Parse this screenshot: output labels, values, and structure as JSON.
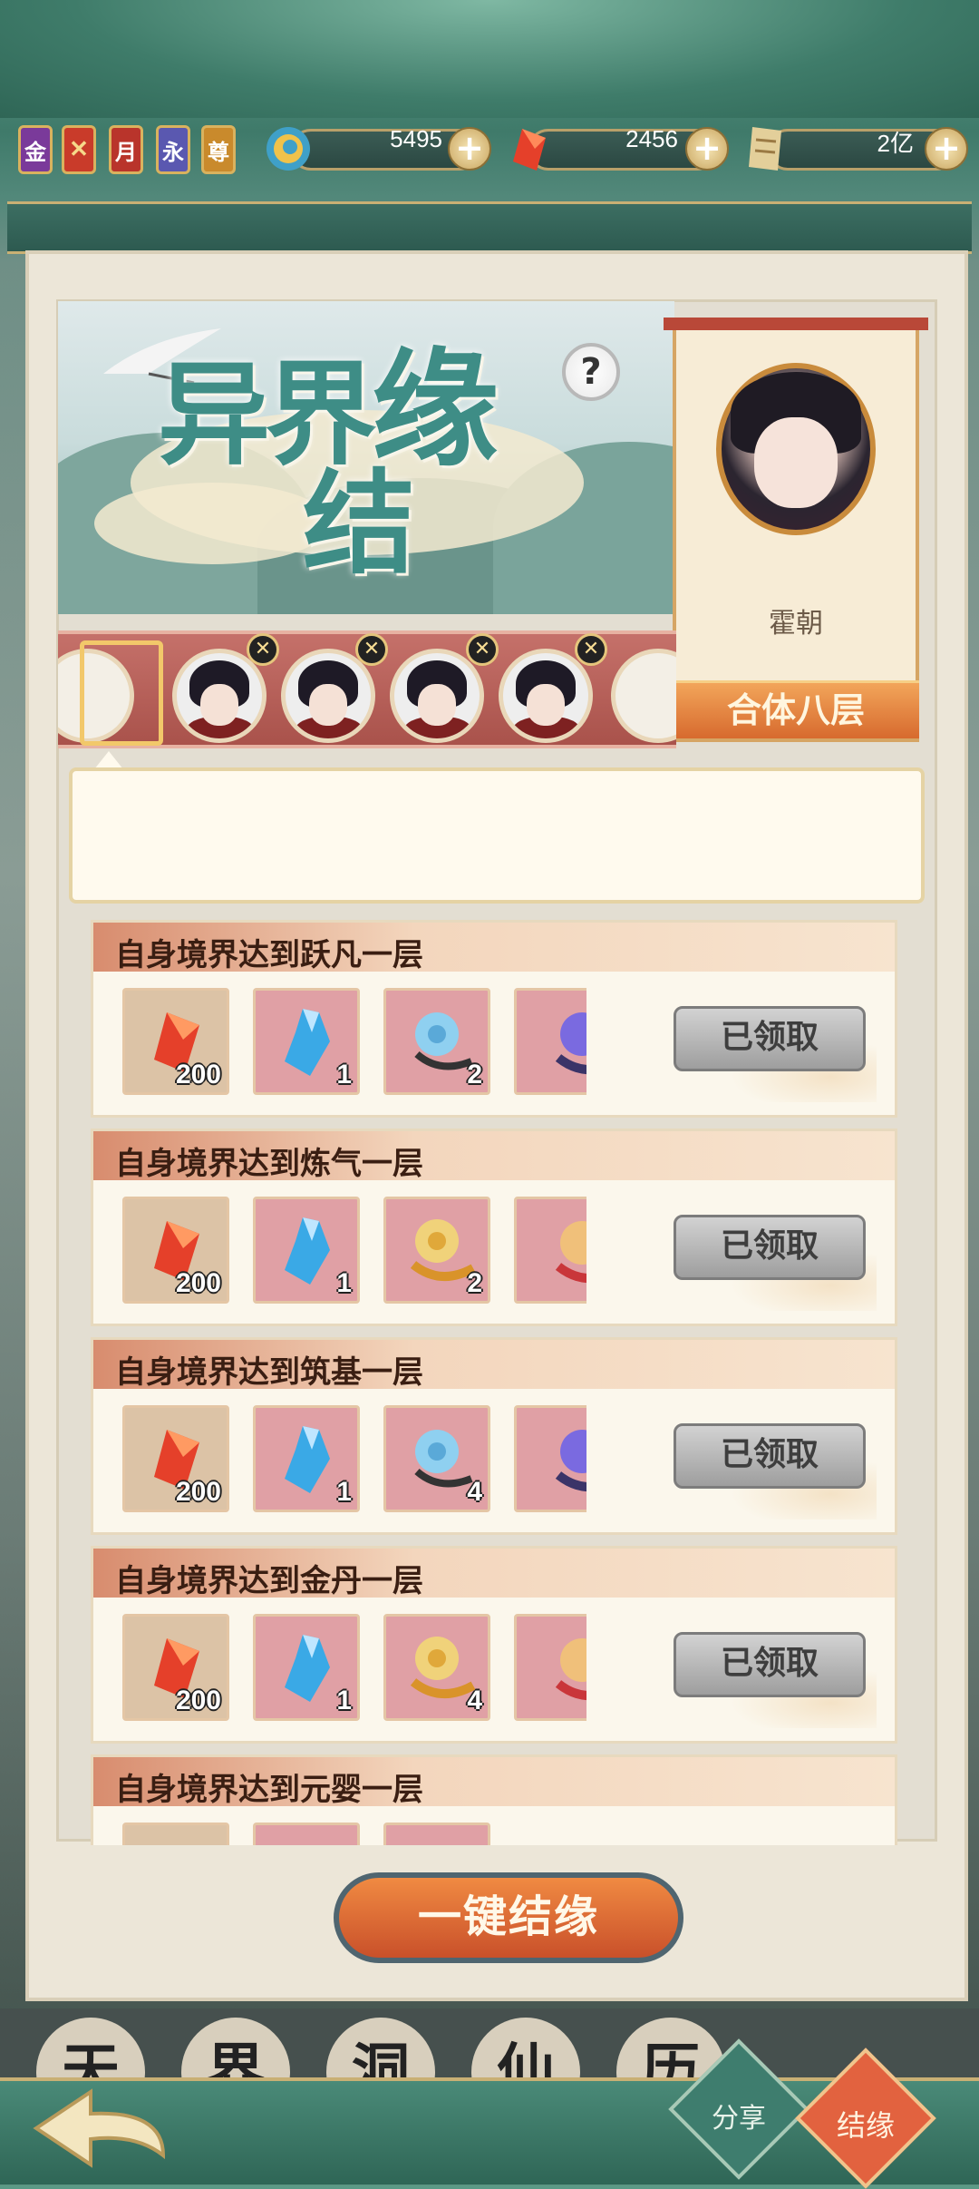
{
  "badges": [
    {
      "label": "金",
      "color": "#7a3a9a"
    },
    {
      "label": "",
      "color": "#c93b2a"
    },
    {
      "label": "月",
      "color": "#b9342b"
    },
    {
      "label": "永",
      "color": "#5a58b0"
    },
    {
      "label": "尊",
      "color": "#c98a2c"
    }
  ],
  "resources": [
    {
      "icon": "jade-spiral-icon",
      "value": "5495"
    },
    {
      "icon": "red-crystal-icon",
      "value": "2456"
    },
    {
      "icon": "scroll-icon",
      "value": "2亿"
    }
  ],
  "banner": {
    "title_line1": "异界",
    "title_char3": "缘",
    "title_line2": "结",
    "help": "?"
  },
  "partner": {
    "name": "霍朝",
    "rank": "合体八层"
  },
  "avatars": [
    {
      "removable": true
    },
    {
      "removable": true
    },
    {
      "removable": true
    },
    {
      "removable": true
    }
  ],
  "tasks": [
    {
      "title": "自身境界达到跃凡一层",
      "items": [
        {
          "type": "crystal",
          "count": "200"
        },
        {
          "type": "bottle",
          "count": "1"
        },
        {
          "type": "blue-charm",
          "count": "2"
        },
        {
          "type": "purple-charm",
          "count": ""
        }
      ],
      "status": "已领取"
    },
    {
      "title": "自身境界达到炼气一层",
      "items": [
        {
          "type": "crystal",
          "count": "200"
        },
        {
          "type": "bottle",
          "count": "1"
        },
        {
          "type": "gold-charm",
          "count": "2"
        },
        {
          "type": "red-charm",
          "count": ""
        }
      ],
      "status": "已领取"
    },
    {
      "title": "自身境界达到筑基一层",
      "items": [
        {
          "type": "crystal",
          "count": "200"
        },
        {
          "type": "bottle",
          "count": "1"
        },
        {
          "type": "blue-charm",
          "count": "4"
        },
        {
          "type": "purple-charm",
          "count": ""
        }
      ],
      "status": "已领取"
    },
    {
      "title": "自身境界达到金丹一层",
      "items": [
        {
          "type": "crystal",
          "count": "200"
        },
        {
          "type": "bottle",
          "count": "1"
        },
        {
          "type": "gold-charm",
          "count": "4"
        },
        {
          "type": "red-charm",
          "count": ""
        }
      ],
      "status": "已领取"
    },
    {
      "title": "自身境界达到元婴一层",
      "items": [],
      "status": ""
    }
  ],
  "one_key_button": "一键结缘",
  "bottom_tabs": [
    "天",
    "界",
    "洞",
    "仙",
    "历"
  ],
  "footer": {
    "share": "分享",
    "jieyuan": "结缘"
  }
}
